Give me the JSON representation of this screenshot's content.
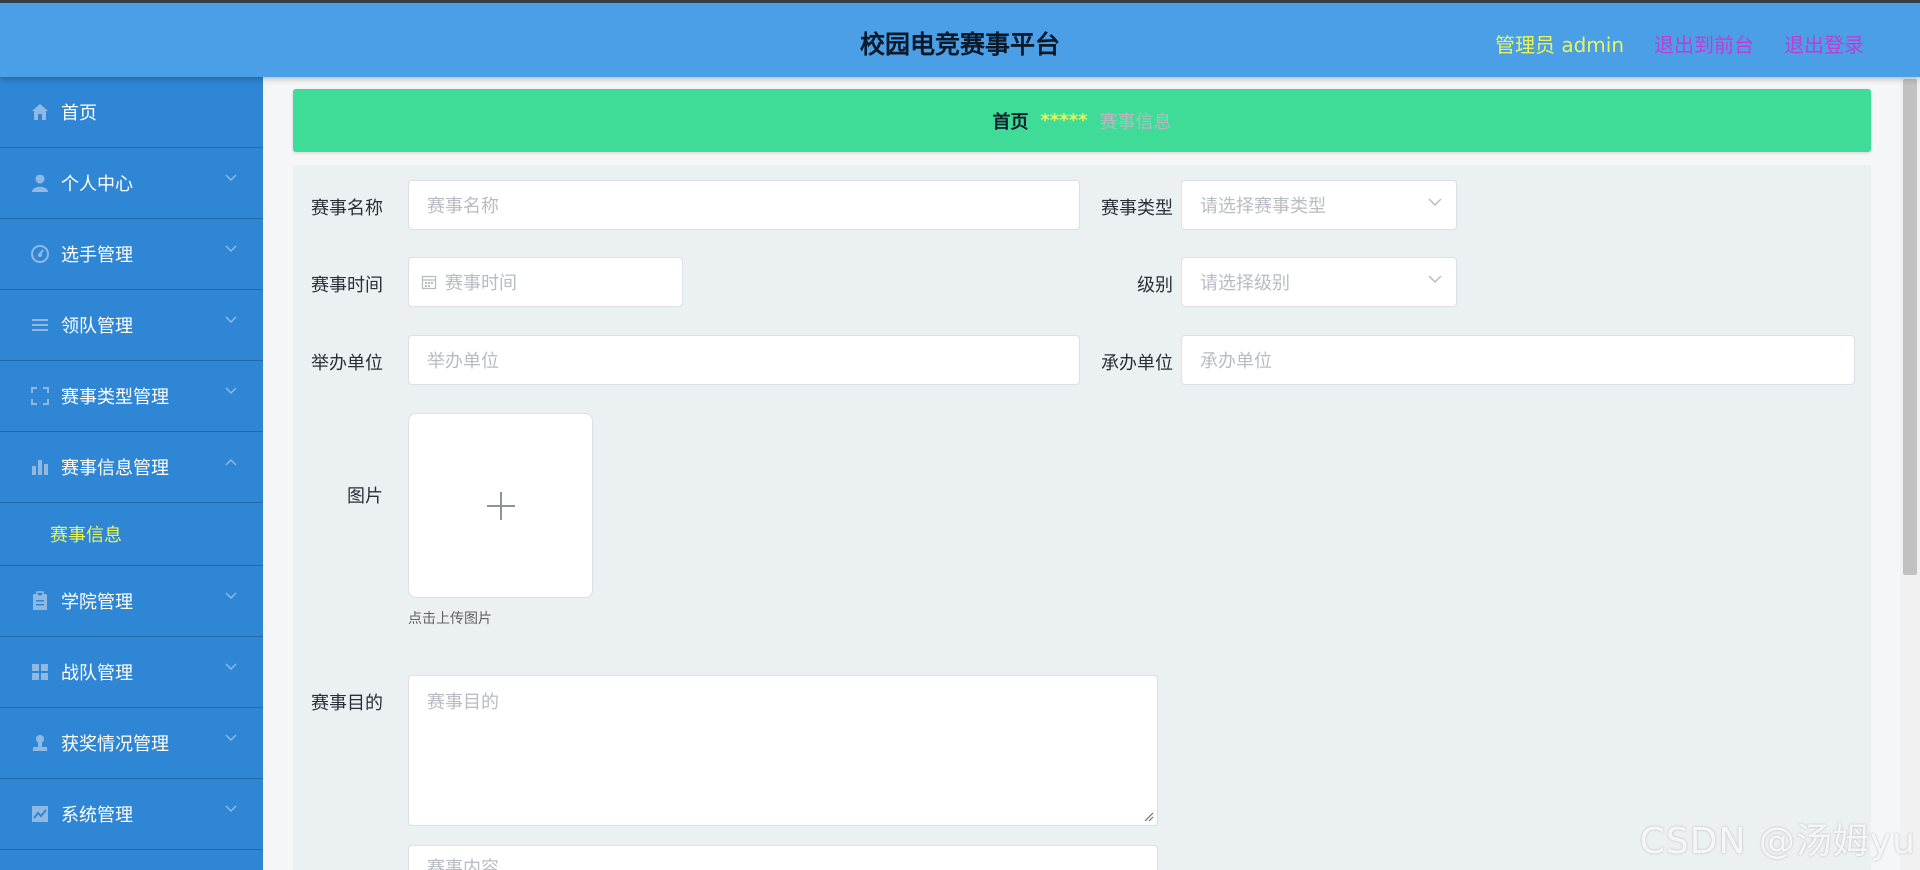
{
  "header": {
    "title": "校园电竞赛事平台",
    "role_label": "管理员",
    "username": "admin",
    "front_link": "退出到前台",
    "logout_link": "退出登录"
  },
  "sidebar": {
    "items": [
      {
        "label": "首页",
        "icon": "home-icon"
      },
      {
        "label": "个人中心",
        "icon": "user-icon"
      },
      {
        "label": "选手管理",
        "icon": "gauge-icon"
      },
      {
        "label": "领队管理",
        "icon": "list-icon"
      },
      {
        "label": "赛事类型管理",
        "icon": "fullscreen-icon"
      },
      {
        "label": "赛事信息管理",
        "icon": "bar-chart-icon",
        "expanded": true
      },
      {
        "label": "学院管理",
        "icon": "clipboard-icon"
      },
      {
        "label": "战队管理",
        "icon": "grid-icon"
      },
      {
        "label": "获奖情况管理",
        "icon": "stamp-icon"
      },
      {
        "label": "系统管理",
        "icon": "line-chart-icon"
      }
    ],
    "active_sub": "赛事信息"
  },
  "breadcrumb": {
    "home": "首页",
    "separator": "*****",
    "current": "赛事信息"
  },
  "form": {
    "name_label": "赛事名称",
    "name_placeholder": "赛事名称",
    "type_label": "赛事类型",
    "type_placeholder": "请选择赛事类型",
    "time_label": "赛事时间",
    "time_placeholder": "赛事时间",
    "level_label": "级别",
    "level_placeholder": "请选择级别",
    "host_label": "举办单位",
    "host_placeholder": "举办单位",
    "organizer_label": "承办单位",
    "organizer_placeholder": "承办单位",
    "image_label": "图片",
    "upload_tip": "点击上传图片",
    "purpose_label": "赛事目的",
    "purpose_placeholder": "赛事目的",
    "next_placeholder": "赛事内容"
  },
  "watermark": "CSDN @汤姆yu",
  "colors": {
    "header_bg": "#4b9fe6",
    "sidebar_bg": "#2f86d4",
    "breadcrumb_bg": "#3fdc98",
    "accent_yellow": "#e8f55a",
    "link_purple": "#c23bd6"
  }
}
